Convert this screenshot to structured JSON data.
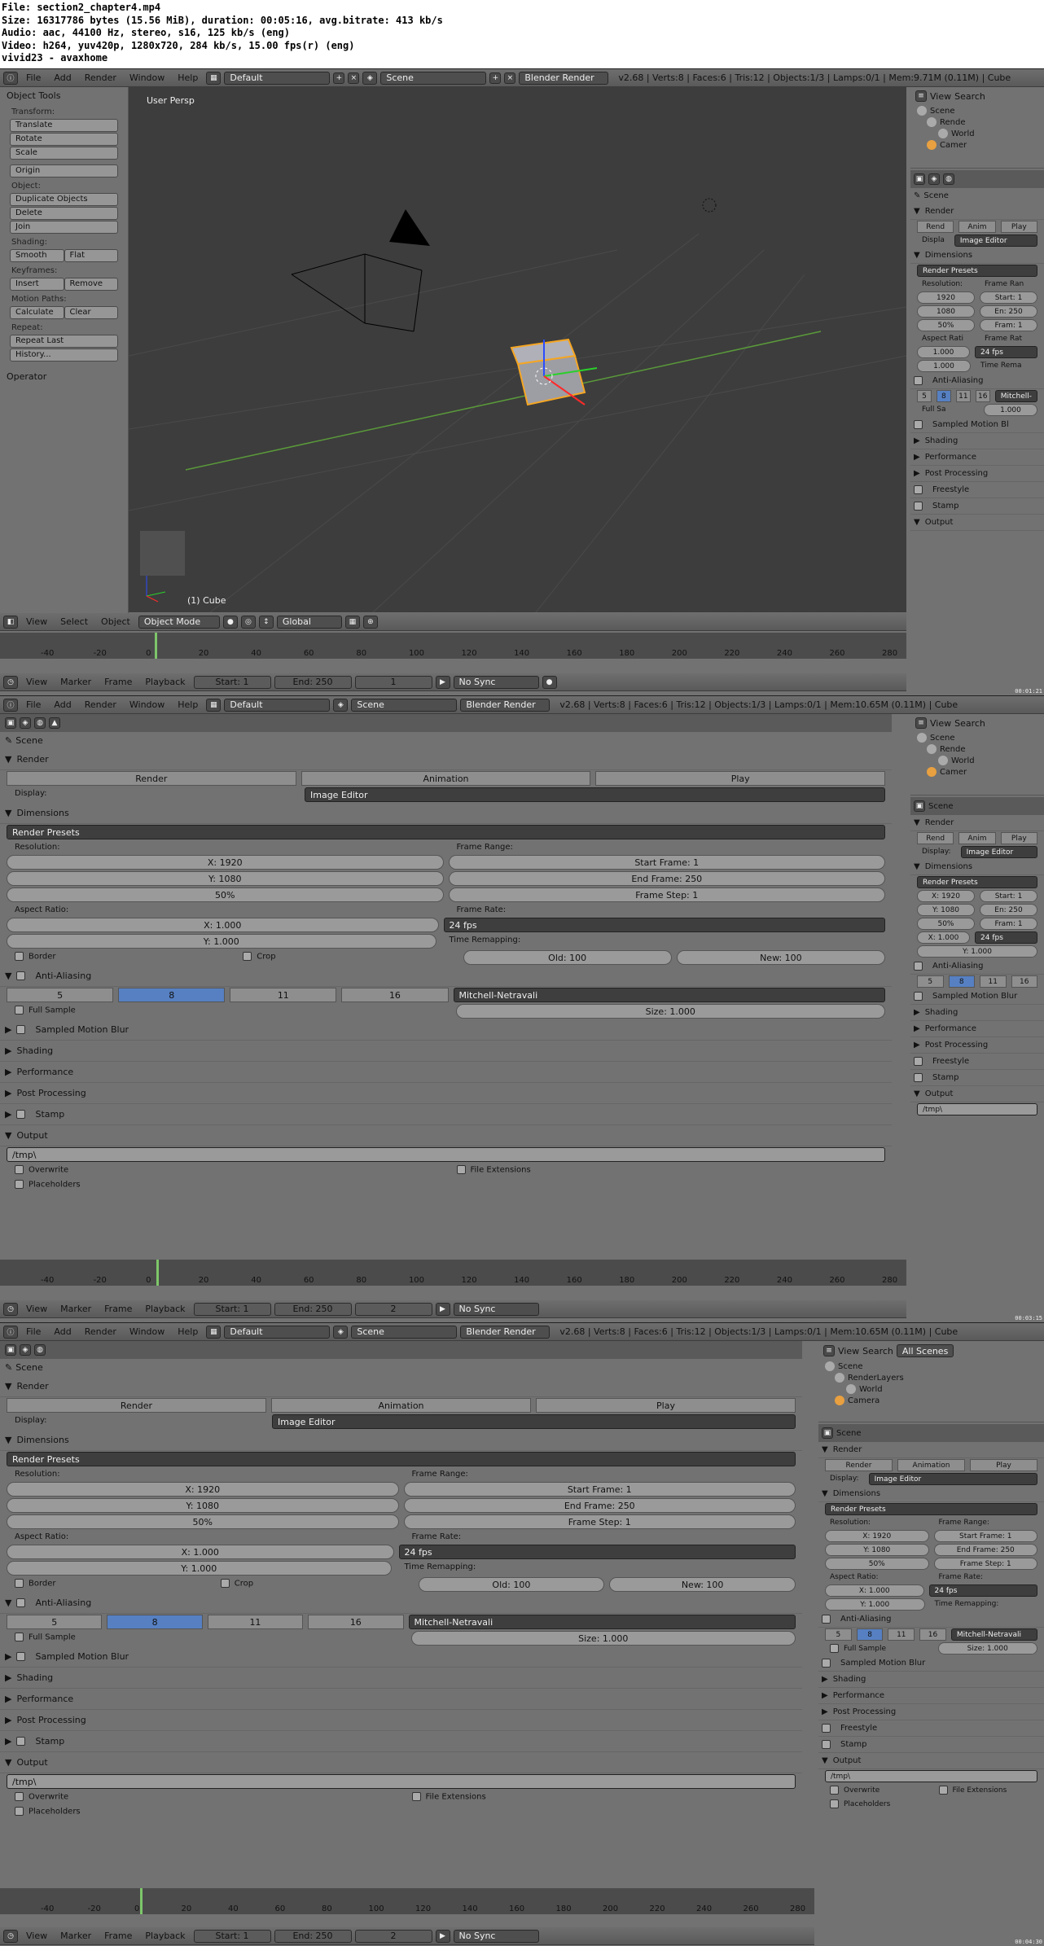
{
  "file_info": {
    "line1": "File: section2_chapter4.mp4",
    "line2": "Size: 16317786 bytes (15.56 MiB), duration: 00:05:16, avg.bitrate: 413 kb/s",
    "line3": "Audio: aac, 44100 Hz, stereo, s16, 125 kb/s (eng)",
    "line4": "Video: h264, yuv420p, 1280x720, 284 kb/s, 15.00 fps(r) (eng)",
    "line5": "vivid23 - avaxhome"
  },
  "menu": {
    "file": "File",
    "add": "Add",
    "render": "Render",
    "window": "Window",
    "help": "Help"
  },
  "topbar": {
    "layout": "Default",
    "scene": "Scene",
    "engine": "Blender Render",
    "stats1": "v2.68 | Verts:8 | Faces:6 | Tris:12 | Objects:1/3 | Lamps:0/1 | Mem:9.71M (0.11M) | Cube",
    "stats2": "v2.68 | Verts:8 | Faces:6 | Tris:12 | Objects:1/3 | Lamps:0/1 | Mem:10.65M (0.11M) | Cube",
    "stats3": "v2.68 | Verts:8 | Faces:6 | Tris:12 | Objects:1/3 | Lamps:0/1 | Mem:10.65M (0.11M) | Cube"
  },
  "tools": {
    "title": "Object Tools",
    "transform": "Transform:",
    "translate": "Translate",
    "rotate": "Rotate",
    "scale": "Scale",
    "origin": "Origin",
    "object": "Object:",
    "duplicate": "Duplicate Objects",
    "delete": "Delete",
    "join": "Join",
    "shading": "Shading:",
    "smooth": "Smooth",
    "flat": "Flat",
    "keyframes": "Keyframes:",
    "insert": "Insert",
    "remove": "Remove",
    "motion": "Motion Paths:",
    "calculate": "Calculate",
    "clear": "Clear",
    "repeat": "Repeat:",
    "repeat_last": "Repeat Last",
    "history": "History...",
    "operator": "Operator"
  },
  "viewport": {
    "persp": "User Persp",
    "objname": "(1) Cube"
  },
  "vpheader": {
    "view": "View",
    "select": "Select",
    "object": "Object",
    "mode": "Object Mode",
    "orient": "Global"
  },
  "timeline": {
    "view": "View",
    "marker": "Marker",
    "frame": "Frame",
    "playback": "Playback",
    "start": "Start: 1",
    "end": "End: 250",
    "cur1": "1",
    "cur2": "2",
    "cur3": "2",
    "sync": "No Sync",
    "ticks": [
      "-40",
      "-20",
      "0",
      "20",
      "40",
      "60",
      "80",
      "100",
      "120",
      "140",
      "160",
      "180",
      "200",
      "220",
      "240",
      "260",
      "280"
    ]
  },
  "outliner": {
    "view": "View",
    "search": "Search",
    "all": "All Scenes",
    "scene": "Scene",
    "renderlayers": "RenderLayers",
    "render_short": "Rende",
    "world": "World",
    "camera": "Camera",
    "camera_short": "Camer"
  },
  "props": {
    "scene": "Scene",
    "render": "Render",
    "render_btn": "Render",
    "anim_btn": "Animation",
    "play_btn": "Play",
    "display": "Display:",
    "display_val": "Image Editor",
    "dimensions": "Dimensions",
    "presets": "Render Presets",
    "resolution": "Resolution:",
    "res_x": "X: 1920",
    "res_y": "Y: 1080",
    "res_pct": "50%",
    "frame_range": "Frame Range:",
    "start_frame": "Start Frame: 1",
    "end_frame": "End Frame: 250",
    "frame_step": "Frame Step: 1",
    "aspect": "Aspect Ratio:",
    "asp_x": "X: 1.000",
    "asp_y": "Y: 1.000",
    "frame_rate": "Frame Rate:",
    "fps": "24 fps",
    "time_remap": "Time Remapping:",
    "old": "Old: 100",
    "new": "New: 100",
    "border": "Border",
    "crop": "Crop",
    "aa": "Anti-Aliasing",
    "aa5": "5",
    "aa8": "8",
    "aa11": "11",
    "aa16": "16",
    "filter": "Mitchell-Netravali",
    "full_sample": "Full Sample",
    "size": "Size: 1.000",
    "smb": "Sampled Motion Blur",
    "shading": "Shading",
    "performance": "Performance",
    "post": "Post Processing",
    "freestyle": "Freestyle",
    "stamp": "Stamp",
    "output": "Output",
    "tmp": "/tmp\\",
    "overwrite": "Overwrite",
    "file_ext": "File Extensions",
    "placeholders": "Placeholders"
  },
  "small_props": {
    "render_s": "Rend",
    "anim_s": "Anim",
    "play_s": "Play",
    "displ": "Displa",
    "disp_val": "Image Editor",
    "resolution": "Resolution:",
    "frame_ran": "Frame Ran",
    "x": "1920",
    "y": "1080",
    "pct": "50%",
    "st": "Start: 1",
    "en": "En: 250",
    "fr": "Fram: 1",
    "aspect": "Aspect Rati",
    "frame_rat": "Frame Rat",
    "ax": "1.000",
    "ay": "1.000",
    "fps": "24 fps",
    "time_rema": "Time Rema",
    "one": "1",
    "full_sa": "Full Sa",
    "mitch": "Mitchell-",
    "size": "1.000",
    "smb": "Sampled Motion Bl",
    "output": "Output"
  },
  "timecodes": [
    "00:01:21",
    "00:03:15",
    "00:04:30"
  ]
}
